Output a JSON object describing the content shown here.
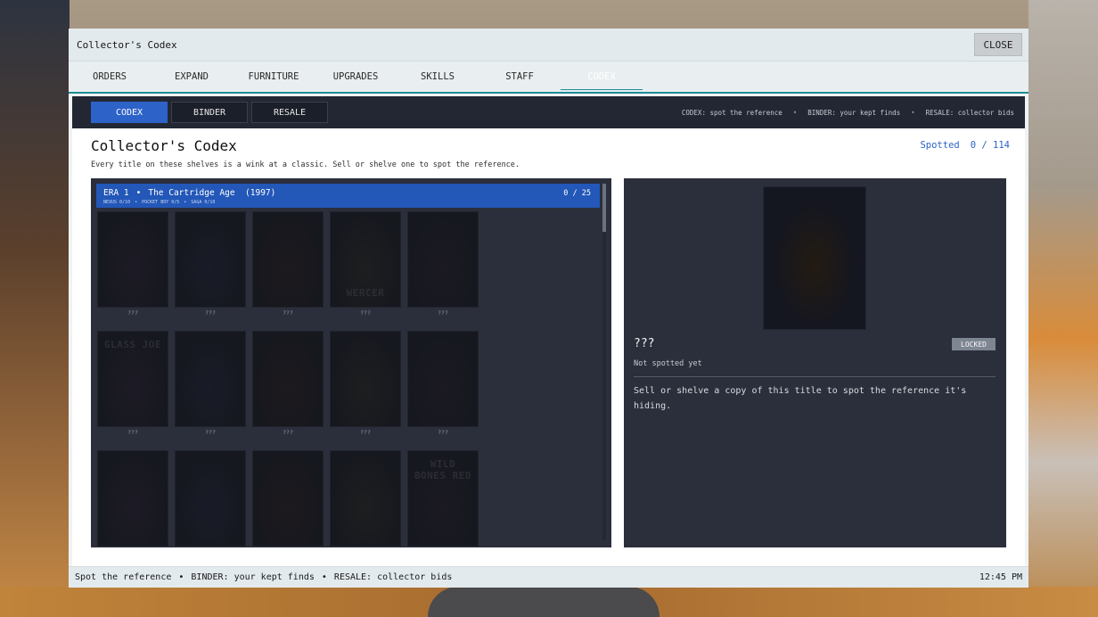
{
  "window": {
    "title": "Collector's Codex",
    "close_label": "CLOSE"
  },
  "tabs": [
    {
      "label": "ORDERS"
    },
    {
      "label": "EXPAND"
    },
    {
      "label": "FURNITURE"
    },
    {
      "label": "UPGRADES"
    },
    {
      "label": "SKILLS"
    },
    {
      "label": "STAFF"
    },
    {
      "label": "CODEX",
      "active": true
    }
  ],
  "subnav": {
    "tabs": [
      {
        "label": "CODEX",
        "active": true
      },
      {
        "label": "BINDER"
      },
      {
        "label": "RESALE"
      }
    ],
    "hints": [
      "CODEX: spot the reference",
      "BINDER: your kept finds",
      "RESALE: collector bids"
    ]
  },
  "page": {
    "title": "Collector's Codex",
    "subtitle": "Every title on these shelves is a wink at a classic. Sell or shelve one to spot the reference.",
    "spotted_label": "Spotted",
    "spotted_count": "0 / 114"
  },
  "era": {
    "label": "ERA 1",
    "name": "The Cartridge Age",
    "year": "(1997)",
    "count": "0 / 25",
    "sub": [
      "NEXUS 0/10",
      "POCKET BOY 0/5",
      "SAGA 0/10"
    ]
  },
  "cards": [
    {
      "label": "???",
      "faint": ""
    },
    {
      "label": "???",
      "faint": ""
    },
    {
      "label": "???",
      "faint": ""
    },
    {
      "label": "???",
      "faint": "WERCER"
    },
    {
      "label": "???",
      "faint": ""
    },
    {
      "label": "???",
      "faint": "GLASS JOE"
    },
    {
      "label": "???",
      "faint": ""
    },
    {
      "label": "???",
      "faint": ""
    },
    {
      "label": "???",
      "faint": ""
    },
    {
      "label": "???",
      "faint": ""
    },
    {
      "label": "",
      "faint": ""
    },
    {
      "label": "",
      "faint": ""
    },
    {
      "label": "",
      "faint": ""
    },
    {
      "label": "",
      "faint": ""
    },
    {
      "label": "",
      "faint": "WILD BONES RED"
    }
  ],
  "detail": {
    "name": "???",
    "status": "Not spotted yet",
    "badge": "LOCKED",
    "description": "Sell or shelve a copy of this title to spot the reference it's hiding."
  },
  "statusbar": {
    "items": [
      "Spot the reference",
      "BINDER: your kept finds",
      "RESALE: collector bids"
    ],
    "time": "12:45 PM"
  }
}
